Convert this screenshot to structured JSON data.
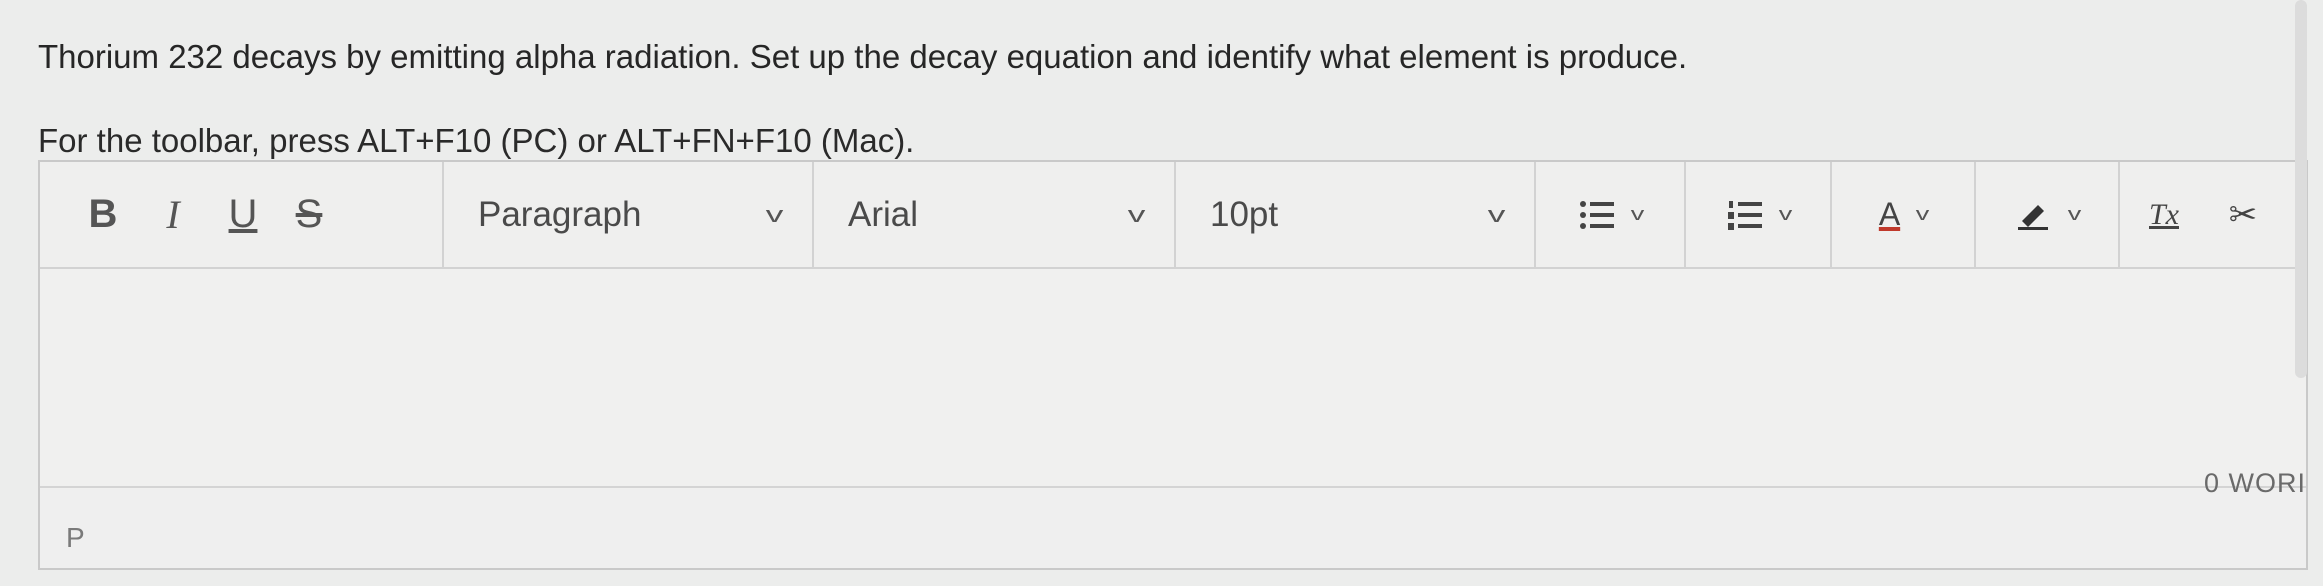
{
  "question": "Thorium 232 decays by emitting alpha radiation. Set up the decay equation and identify what element is produce.",
  "toolbar_hint": "For the toolbar, press ALT+F10 (PC) or ALT+FN+F10 (Mac).",
  "toolbar": {
    "bold": "B",
    "italic": "I",
    "underline": "U",
    "strikethrough": "S",
    "block_format": "Paragraph",
    "font_family": "Arial",
    "font_size": "10pt",
    "text_color": "A",
    "clear_format": "Tx"
  },
  "statusbar": {
    "path": "P",
    "word_count": "0 WORI"
  },
  "icons": [
    "bullet-list-icon",
    "numbered-list-icon",
    "text-color-icon",
    "highlight-pen-icon",
    "clear-formatting-icon",
    "cut-icon",
    "chevron-down-icon"
  ]
}
